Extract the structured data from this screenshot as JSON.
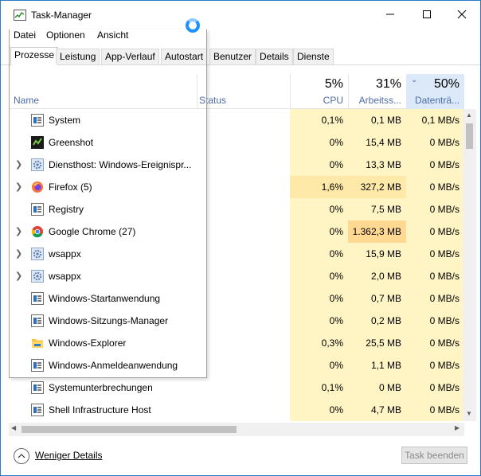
{
  "window": {
    "title": "Task-Manager"
  },
  "menu": [
    {
      "label": "Datei"
    },
    {
      "label": "Optionen"
    },
    {
      "label": "Ansicht"
    }
  ],
  "tabs": [
    {
      "label": "Prozesse",
      "active": true
    },
    {
      "label": "Leistung"
    },
    {
      "label": "App-Verlauf"
    },
    {
      "label": "Autostart"
    },
    {
      "label": "Benutzer"
    },
    {
      "label": "Details"
    },
    {
      "label": "Dienste"
    }
  ],
  "columns": {
    "name": "Name",
    "status": "Status",
    "cpu": {
      "pct": "5%",
      "label": "CPU"
    },
    "memory": {
      "pct": "31%",
      "label": "Arbeitss..."
    },
    "disk": {
      "pct": "50%",
      "label": "Datenträ..."
    }
  },
  "processes": [
    {
      "name": "System",
      "icon": "window-icon",
      "expandable": false,
      "cpu": "0,1%",
      "mem": "0,1 MB",
      "disk": "0,1 MB/s"
    },
    {
      "name": "Greenshot",
      "icon": "greenshot-icon",
      "expandable": false,
      "cpu": "0%",
      "mem": "15,4 MB",
      "disk": "0 MB/s"
    },
    {
      "name": "Diensthost: Windows-Ereignispr...",
      "icon": "gear-icon",
      "expandable": true,
      "cpu": "0%",
      "mem": "13,3 MB",
      "disk": "0 MB/s"
    },
    {
      "name": "Firefox (5)",
      "icon": "firefox-icon",
      "expandable": true,
      "cpu": "1,6%",
      "mem": "327,2 MB",
      "disk": "0 MB/s"
    },
    {
      "name": "Registry",
      "icon": "window-icon",
      "expandable": false,
      "cpu": "0%",
      "mem": "7,5 MB",
      "disk": "0 MB/s"
    },
    {
      "name": "Google Chrome (27)",
      "icon": "chrome-icon",
      "expandable": true,
      "cpu": "0%",
      "mem": "1.362,3 MB",
      "disk": "0 MB/s"
    },
    {
      "name": "wsappx",
      "icon": "gear-icon",
      "expandable": true,
      "cpu": "0%",
      "mem": "15,9 MB",
      "disk": "0 MB/s"
    },
    {
      "name": "wsappx",
      "icon": "gear-icon",
      "expandable": true,
      "cpu": "0%",
      "mem": "2,0 MB",
      "disk": "0 MB/s"
    },
    {
      "name": "Windows-Startanwendung",
      "icon": "window-icon",
      "expandable": false,
      "cpu": "0%",
      "mem": "0,7 MB",
      "disk": "0 MB/s"
    },
    {
      "name": "Windows-Sitzungs-Manager",
      "icon": "window-icon",
      "expandable": false,
      "cpu": "0%",
      "mem": "0,2 MB",
      "disk": "0 MB/s"
    },
    {
      "name": "Windows-Explorer",
      "icon": "folder-icon",
      "expandable": false,
      "cpu": "0,3%",
      "mem": "25,5 MB",
      "disk": "0 MB/s"
    },
    {
      "name": "Windows-Anmeldeanwendung",
      "icon": "window-icon",
      "expandable": false,
      "cpu": "0%",
      "mem": "1,1 MB",
      "disk": "0 MB/s"
    },
    {
      "name": "Systemunterbrechungen",
      "icon": "window-icon",
      "expandable": false,
      "cpu": "0,1%",
      "mem": "0 MB",
      "disk": "0 MB/s"
    },
    {
      "name": "Shell Infrastructure Host",
      "icon": "window-icon",
      "expandable": false,
      "cpu": "0%",
      "mem": "4,7 MB",
      "disk": "0 MB/s"
    }
  ],
  "footer": {
    "fewer_details": "Weniger Details",
    "end_task": "Task beenden"
  },
  "colors": {
    "accent": "#2b78c5",
    "heat_low": "#fff4c4",
    "heat_mid": "#ffe9a8",
    "heat_high": "#ffd992",
    "sorted_header": "#dbe9f8"
  }
}
